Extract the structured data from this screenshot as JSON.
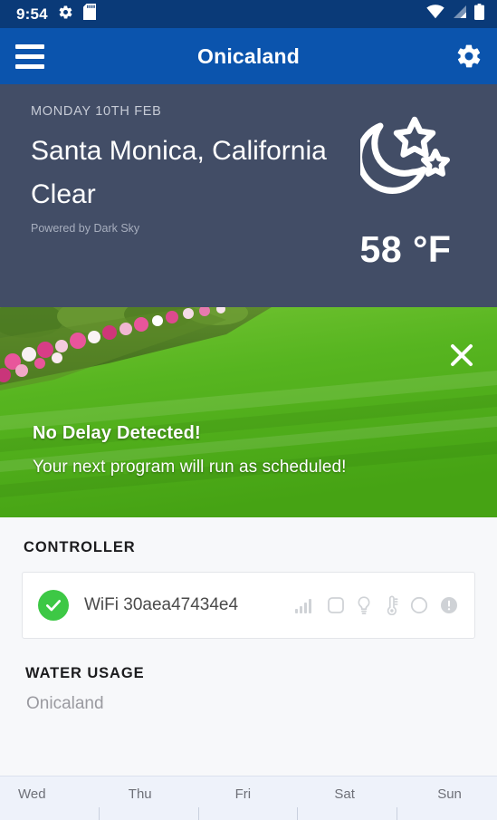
{
  "statusbar": {
    "time": "9:54",
    "icons": [
      "gear-icon",
      "sd-card-icon",
      "wifi-icon",
      "cellular-signal-icon",
      "battery-icon"
    ]
  },
  "appbar": {
    "title": "Onicaland",
    "menu_icon": "hamburger-menu-icon",
    "settings_icon": "gear-icon"
  },
  "weather": {
    "date": "MONDAY 10TH FEB",
    "location": "Santa Monica, California",
    "condition": "Clear",
    "attribution": "Powered by Dark Sky",
    "temperature": "58 °F",
    "icon": "moon-stars-icon",
    "background_color": "#424D66"
  },
  "banner": {
    "title": "No Delay Detected!",
    "subtitle": "Your next program will run as scheduled!",
    "close_icon": "close-x-icon"
  },
  "controller": {
    "heading": "CONTROLLER",
    "status_icon": "green-check-circle-icon",
    "status_color": "#3DC845",
    "name": "WiFi 30aea47434e4",
    "indicator_icons": [
      "signal-bars-icon",
      "rounded-square-icon",
      "lightbulb-icon",
      "thermometer-icon",
      "circle-outline-icon",
      "alert-exclamation-icon"
    ]
  },
  "water_usage": {
    "heading": "WATER USAGE",
    "subtitle": "Onicaland"
  },
  "chart_data": {
    "type": "bar",
    "title": "WATER USAGE",
    "subtitle": "Onicaland",
    "categories": [
      "Wed",
      "Thu",
      "Fri",
      "Sat",
      "Sun"
    ],
    "values": [
      0,
      0,
      0,
      0,
      0
    ],
    "xlabel": "",
    "ylabel": "",
    "grid": false,
    "legend": "none"
  }
}
